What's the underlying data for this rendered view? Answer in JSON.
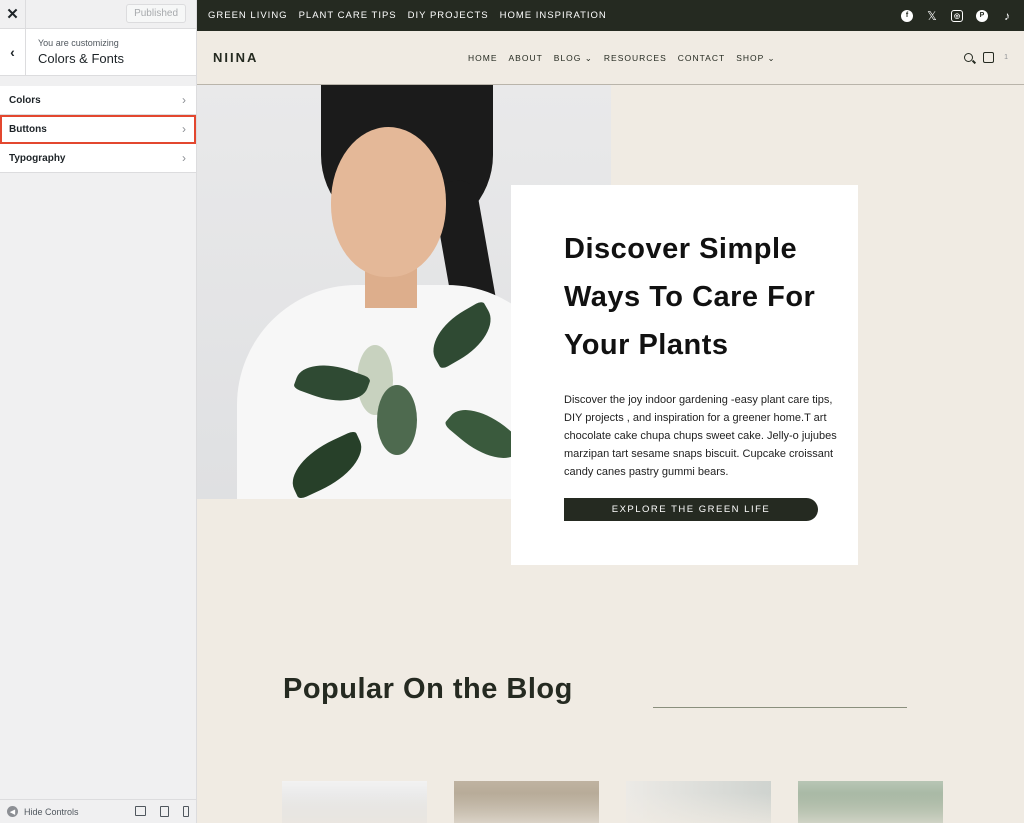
{
  "sidebar": {
    "close_icon": "close-icon",
    "published_label": "Published",
    "customizing_label": "You are customizing",
    "section_title": "Colors & Fonts",
    "items": [
      {
        "label": "Colors"
      },
      {
        "label": "Buttons"
      },
      {
        "label": "Typography"
      }
    ],
    "highlight_color": "#e3472f",
    "hide_controls_label": "Hide Controls"
  },
  "topbar": {
    "nav": [
      "GREEN LIVING",
      "PLANT CARE TIPS",
      "DIY PROJECTS",
      "HOME INSPIRATION"
    ],
    "social_icons": [
      "facebook-icon",
      "x-icon",
      "instagram-icon",
      "pinterest-icon",
      "tiktok-icon"
    ],
    "bg_color": "#252a21"
  },
  "header": {
    "logo": "NIINA",
    "nav": [
      "HOME",
      "ABOUT",
      "BLOG ⌄",
      "RESOURCES",
      "CONTACT",
      "SHOP ⌄"
    ],
    "cart_count": "1"
  },
  "hero": {
    "title": "Discover Simple Ways To Care For Your Plants",
    "text": "Discover the joy indoor gardening -easy plant care tips, DIY projects , and inspiration for a greener home.T art chocolate cake chupa chups sweet cake. Jelly-o jujubes marzipan tart sesame snaps biscuit. Cupcake croissant candy canes pastry gummi bears.",
    "button_label": "EXPLORE THE GREEN LIFE"
  },
  "blog": {
    "title": "Popular On the Blog"
  }
}
